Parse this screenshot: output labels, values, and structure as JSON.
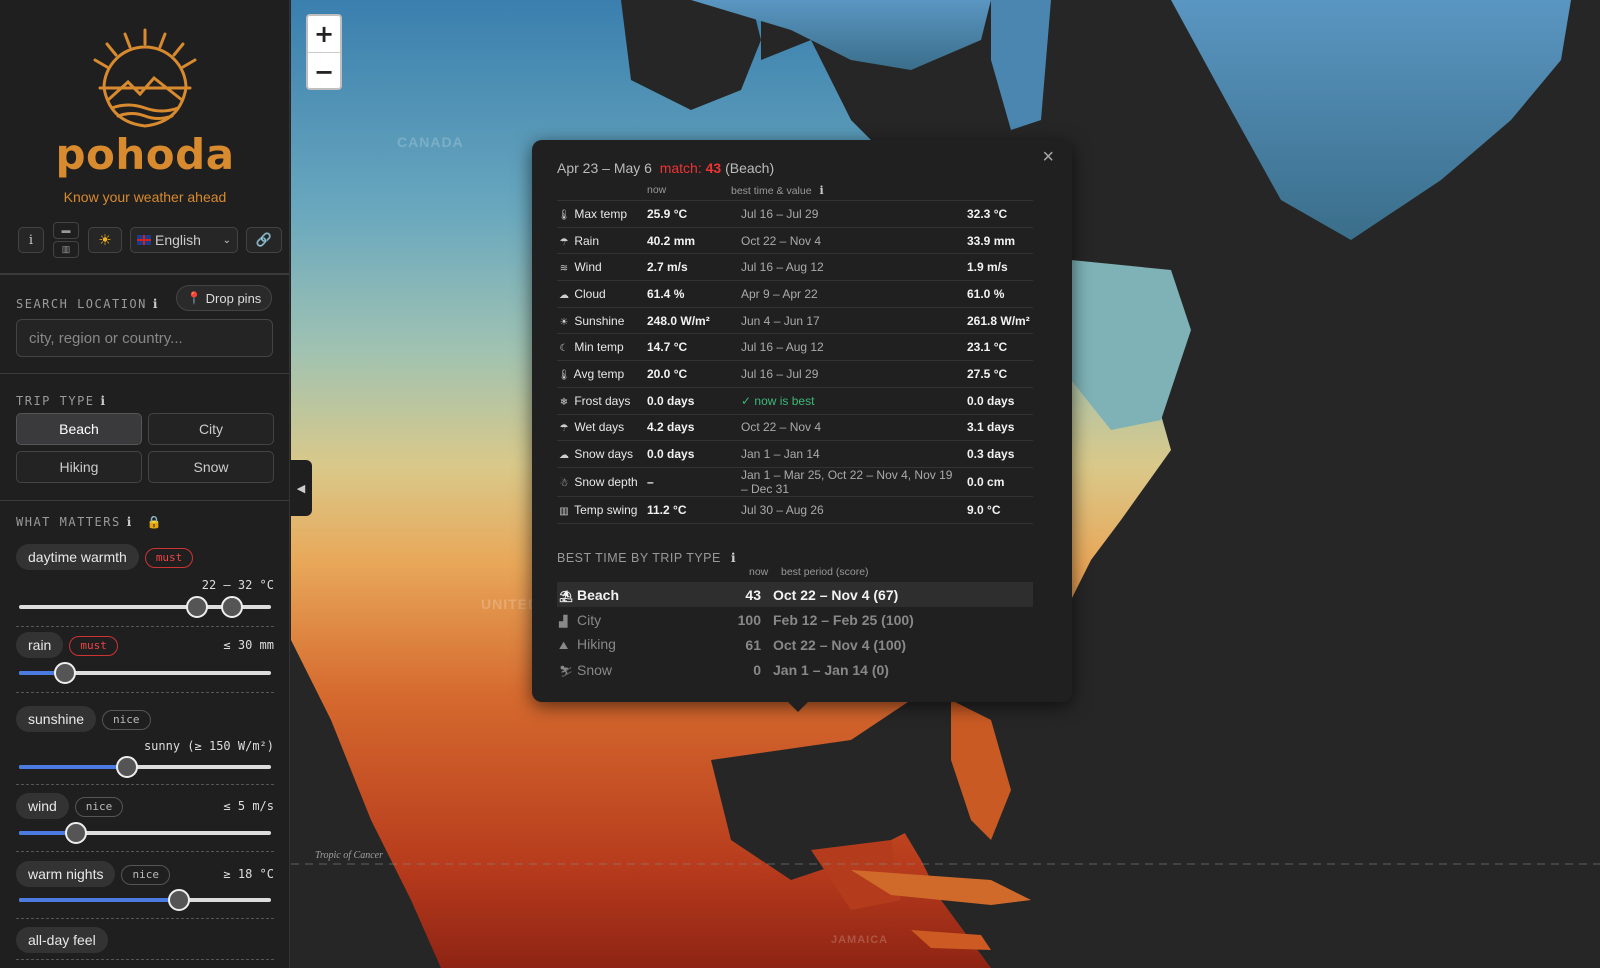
{
  "brand": {
    "name": "pohoda",
    "tagline": "Know your weather ahead"
  },
  "toolbar": {
    "info_label": "i",
    "language": "English"
  },
  "search": {
    "section_label": "SEARCH LOCATION",
    "drop_pins_label": "Drop pins",
    "placeholder": "city, region or country..."
  },
  "trip_type": {
    "section_label": "TRIP TYPE",
    "options": [
      "Beach",
      "City",
      "Hiking",
      "Snow"
    ],
    "selected": "Beach"
  },
  "what_matters": {
    "section_label": "WHAT MATTERS",
    "prefs": [
      {
        "name": "daytime warmth",
        "tag": "must",
        "value": "22 – 32 °C"
      },
      {
        "name": "rain",
        "tag": "must",
        "value": "≤ 30 mm"
      },
      {
        "name": "sunshine",
        "tag": "nice",
        "value": "sunny (≥ 150 W/m²)"
      },
      {
        "name": "wind",
        "tag": "nice",
        "value": "≤ 5 m/s"
      },
      {
        "name": "warm nights",
        "tag": "nice",
        "value": "≥ 18 °C"
      },
      {
        "name": "all-day feel",
        "tag": "",
        "value": ""
      }
    ]
  },
  "map": {
    "labels": [
      "CANADA",
      "UNITED",
      "Tropic of Cancer",
      "JAMAICA"
    ]
  },
  "popup": {
    "period": "Apr 23 – May 6",
    "match_label": "match:",
    "match_value": "43",
    "trip": "(Beach)",
    "col_now": "now",
    "col_best": "best time & value",
    "metrics": [
      {
        "icon": "thermometer-icon",
        "glyph": "🌡",
        "name": "Max temp",
        "now": "25.9 °C",
        "period": "Jul 16 – Jul 29",
        "best": "32.3 °C"
      },
      {
        "icon": "rain-icon",
        "glyph": "☂",
        "name": "Rain",
        "now": "40.2 mm",
        "period": "Oct 22 – Nov 4",
        "best": "33.9 mm"
      },
      {
        "icon": "wind-icon",
        "glyph": "≋",
        "name": "Wind",
        "now": "2.7 m/s",
        "period": "Jul 16 – Aug 12",
        "best": "1.9 m/s"
      },
      {
        "icon": "cloud-icon",
        "glyph": "☁",
        "name": "Cloud",
        "now": "61.4 %",
        "period": "Apr 9 – Apr 22",
        "best": "61.0 %"
      },
      {
        "icon": "sun-icon",
        "glyph": "☀",
        "name": "Sunshine",
        "now": "248.0 W/m²",
        "period": "Jun 4 – Jun 17",
        "best": "261.8 W/m²"
      },
      {
        "icon": "moon-icon",
        "glyph": "☾",
        "name": "Min temp",
        "now": "14.7 °C",
        "period": "Jul 16 – Aug 12",
        "best": "23.1 °C"
      },
      {
        "icon": "thermometer-icon",
        "glyph": "🌡",
        "name": "Avg temp",
        "now": "20.0 °C",
        "period": "Jul 16 – Jul 29",
        "best": "27.5 °C"
      },
      {
        "icon": "snowflake-icon",
        "glyph": "❄",
        "name": "Frost days",
        "now": "0.0 days",
        "period": "✓ now is best",
        "best": "0.0 days"
      },
      {
        "icon": "umbrella-icon",
        "glyph": "☂",
        "name": "Wet days",
        "now": "4.2 days",
        "period": "Oct 22 – Nov 4",
        "best": "3.1 days"
      },
      {
        "icon": "snow-cloud-icon",
        "glyph": "☁",
        "name": "Snow days",
        "now": "0.0 days",
        "period": "Jan 1 – Jan 14",
        "best": "0.3 days"
      },
      {
        "icon": "snowman-icon",
        "glyph": "☃",
        "name": "Snow depth",
        "now": "–",
        "period": "Jan 1 – Mar 25, Oct 22 – Nov 4, Nov 19 – Dec 31",
        "best": "0.0 cm"
      },
      {
        "icon": "chart-icon",
        "glyph": "▥",
        "name": "Temp swing",
        "now": "11.2 °C",
        "period": "Jul 30 – Aug 26",
        "best": "9.0 °C"
      }
    ],
    "best_time_label": "BEST TIME BY TRIP TYPE",
    "bt_col_now": "now",
    "bt_col_best": "best period (score)",
    "trips": [
      {
        "icon": "beach-icon",
        "glyph": "⛱",
        "name": "Beach",
        "now": "43",
        "best": "Oct 22 – Nov 4 (67)"
      },
      {
        "icon": "city-icon",
        "glyph": "▟",
        "name": "City",
        "now": "100",
        "best": "Feb 12 – Feb 25 (100)"
      },
      {
        "icon": "hiking-icon",
        "glyph": "⛰",
        "name": "Hiking",
        "now": "61",
        "best": "Oct 22 – Nov 4 (100)"
      },
      {
        "icon": "snow-icon",
        "glyph": "⛷",
        "name": "Snow",
        "now": "0",
        "best": "Jan 1 – Jan 14 (0)"
      }
    ]
  }
}
